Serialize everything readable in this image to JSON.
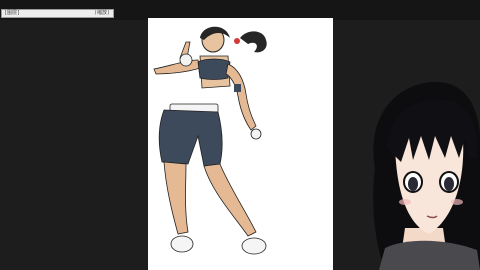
{
  "window": {
    "title_left": "[图层]",
    "title_right": "(缩放)"
  },
  "canvas": {
    "artwork": "character-illustration"
  },
  "overlay": {
    "avatar": "vtuber-avatar"
  }
}
